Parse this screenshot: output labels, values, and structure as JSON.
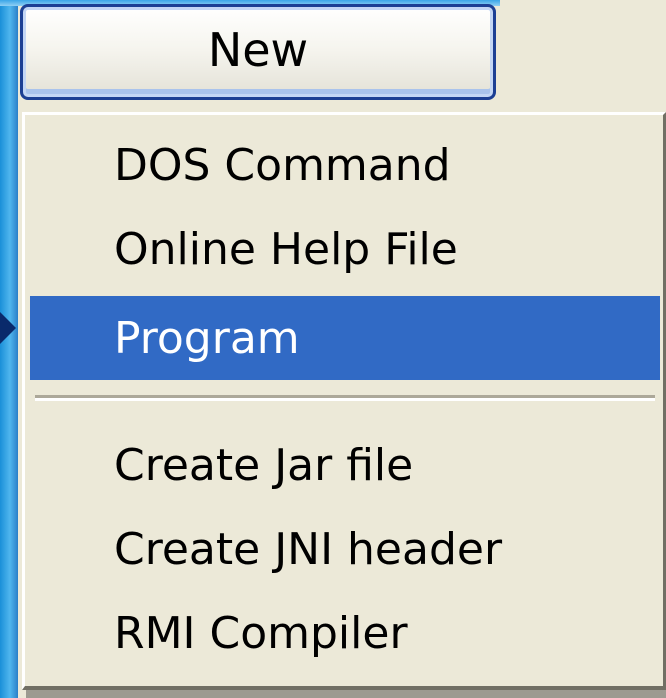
{
  "new_button": {
    "label": "New"
  },
  "menu": {
    "items": [
      {
        "label": "DOS Command",
        "selected": false
      },
      {
        "label": "Online Help File",
        "selected": false
      },
      {
        "label": "Program",
        "selected": true
      },
      {
        "label": "Create Jar file",
        "selected": false
      },
      {
        "label": "Create JNI header",
        "selected": false
      },
      {
        "label": "RMI Compiler",
        "selected": false
      }
    ],
    "selected_color": "#316AC5"
  }
}
